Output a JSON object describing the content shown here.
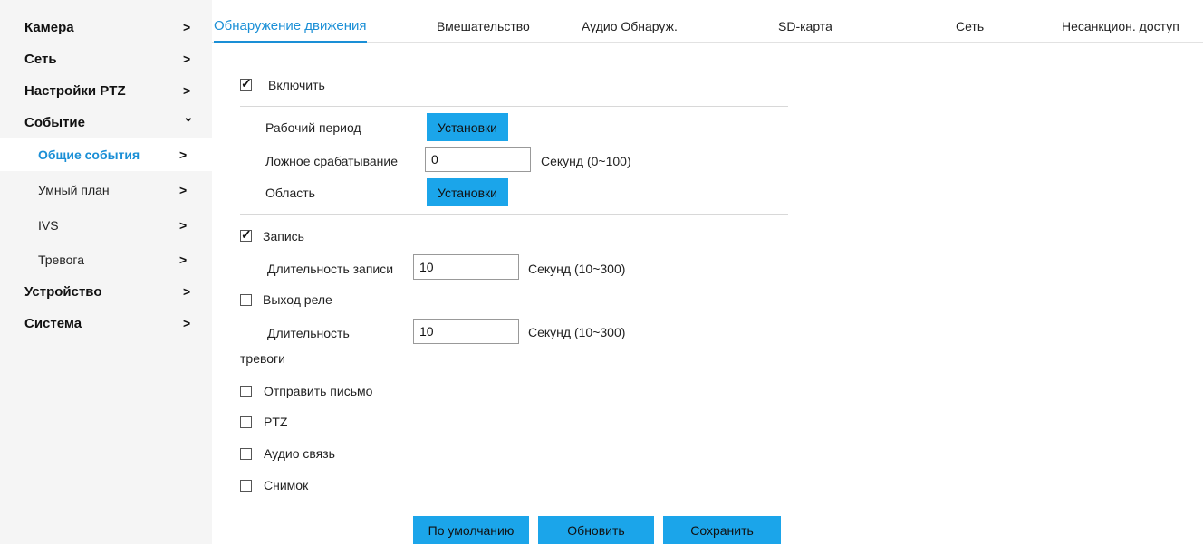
{
  "sidebar": {
    "items": [
      {
        "label": "Камера"
      },
      {
        "label": "Сеть"
      },
      {
        "label": "Настройки PTZ"
      },
      {
        "label": "Событие"
      },
      {
        "label": "Общие события"
      },
      {
        "label": "Умный план"
      },
      {
        "label": "IVS"
      },
      {
        "label": "Тревога"
      },
      {
        "label": "Устройство"
      },
      {
        "label": "Система"
      }
    ],
    "chevron_right": ">",
    "chevron_down": "⌄"
  },
  "tabs": [
    {
      "label": "Обнаружение движения"
    },
    {
      "label": "Вмешательство"
    },
    {
      "label": "Аудио Обнаруж."
    },
    {
      "label": "SD-карта"
    },
    {
      "label": "Сеть"
    },
    {
      "label": "Несанкцион. доступ"
    }
  ],
  "form": {
    "enable": {
      "label": "Включить",
      "checked": true
    },
    "work_period": {
      "label": "Рабочий период",
      "button": "Установки"
    },
    "false_trigger": {
      "label": "Ложное срабатывание",
      "value": "0",
      "hint": "Секунд (0~100)"
    },
    "area": {
      "label": "Область",
      "button": "Установки"
    },
    "record": {
      "label": "Запись",
      "checked": true
    },
    "record_duration": {
      "label": "Длительность записи",
      "value": "10",
      "hint": "Секунд (10~300)"
    },
    "relay_out": {
      "label": "Выход реле",
      "checked": false
    },
    "alarm_duration": {
      "label_line1": "Длительность",
      "label_line2": "тревоги",
      "value": "10",
      "hint": "Секунд (10~300)"
    },
    "send_email": {
      "label": "Отправить письмо",
      "checked": false
    },
    "ptz": {
      "label": "PTZ",
      "checked": false
    },
    "audio_link": {
      "label": "Аудио связь",
      "checked": false
    },
    "snapshot": {
      "label": "Снимок",
      "checked": false
    }
  },
  "actions": {
    "default_label": "По умолчанию",
    "refresh_label": "Обновить",
    "save_label": "Сохранить"
  },
  "colors": {
    "accent": "#1a8fd6",
    "button": "#1ba5ea",
    "sidebar_bg": "#f5f5f5"
  }
}
